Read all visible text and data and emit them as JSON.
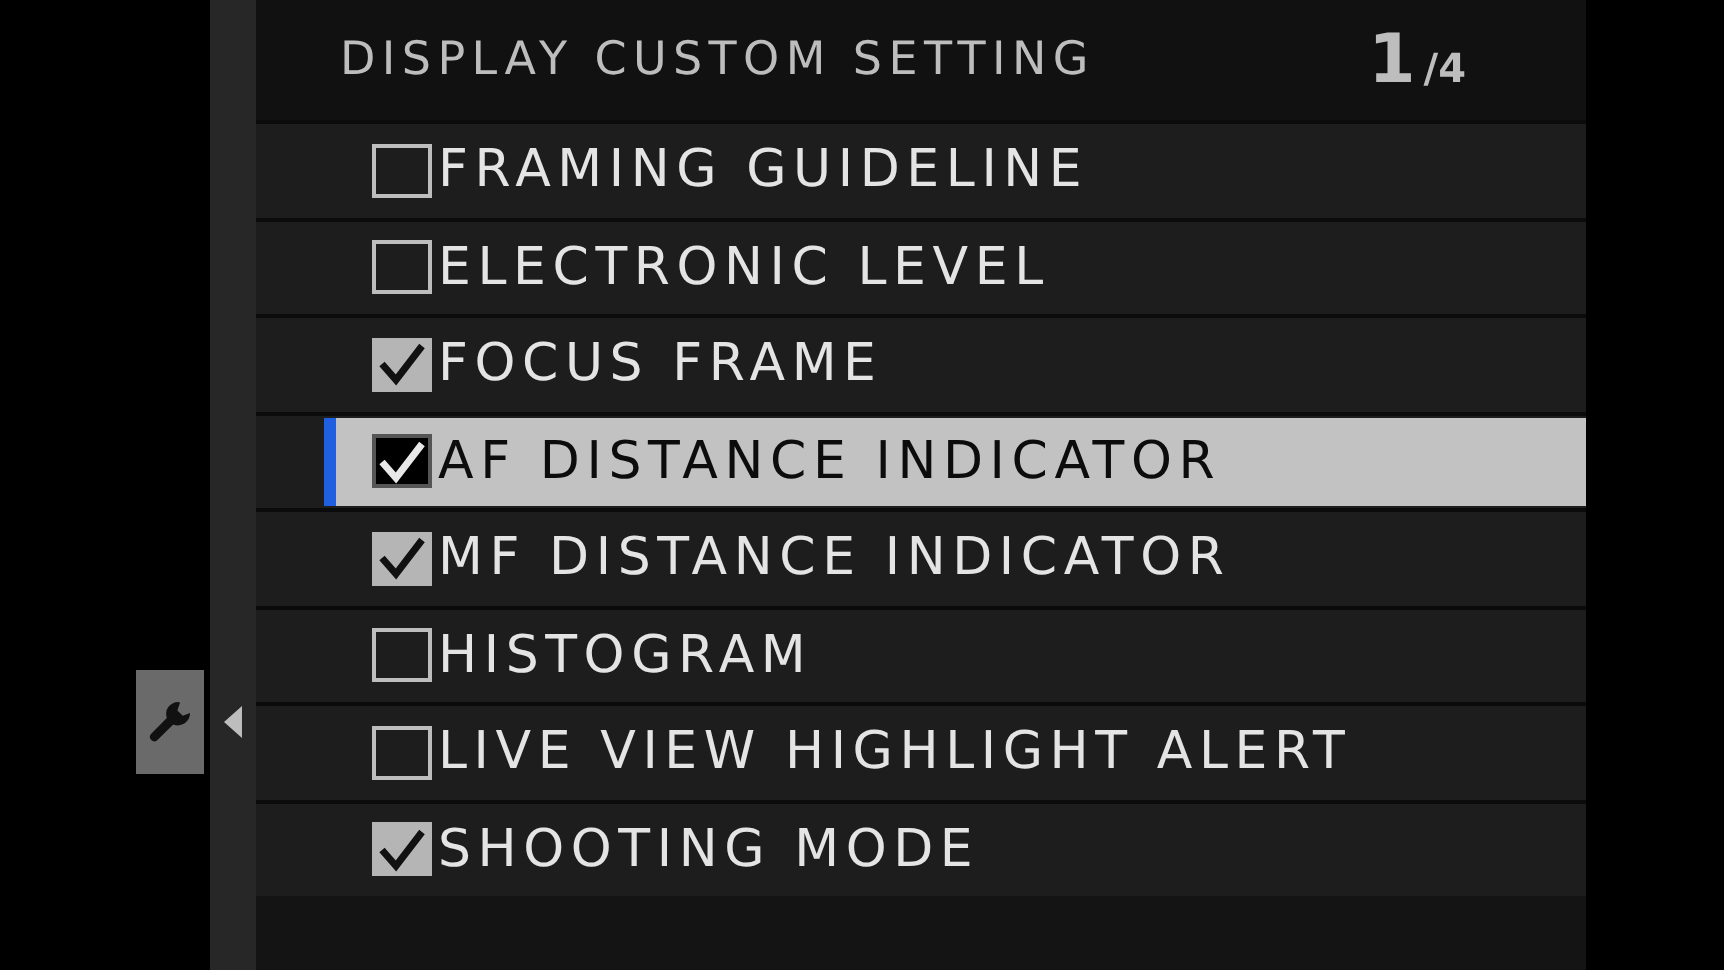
{
  "side_tab": {
    "selected": true
  },
  "header": {
    "title": "DISPLAY CUSTOM SETTING",
    "page": "1",
    "page_total": "/4"
  },
  "items": [
    {
      "label": "FRAMING GUIDELINE",
      "checked": false,
      "selected": false
    },
    {
      "label": "ELECTRONIC LEVEL",
      "checked": false,
      "selected": false
    },
    {
      "label": "FOCUS FRAME",
      "checked": true,
      "selected": false
    },
    {
      "label": "AF DISTANCE INDICATOR",
      "checked": true,
      "selected": true
    },
    {
      "label": "MF DISTANCE INDICATOR",
      "checked": true,
      "selected": false
    },
    {
      "label": "HISTOGRAM",
      "checked": false,
      "selected": false
    },
    {
      "label": "LIVE VIEW HIGHLIGHT ALERT",
      "checked": false,
      "selected": false
    },
    {
      "label": "SHOOTING MODE",
      "checked": true,
      "selected": false
    }
  ]
}
